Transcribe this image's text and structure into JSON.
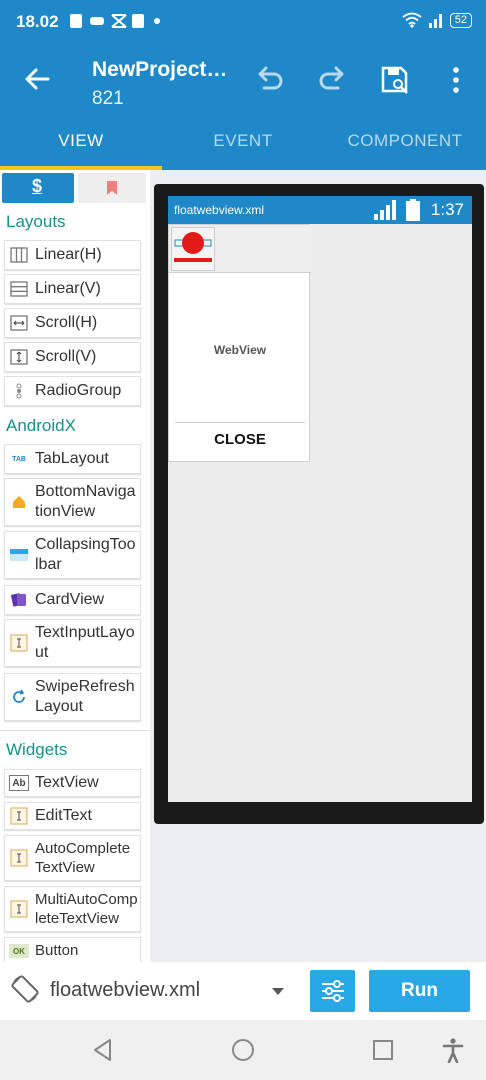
{
  "status_bar": {
    "time": "18.02",
    "battery": "52"
  },
  "app_bar": {
    "title": "NewProject…",
    "subtitle": "821"
  },
  "tabs": [
    {
      "label": "VIEW"
    },
    {
      "label": "EVENT"
    },
    {
      "label": "COMPONENT"
    }
  ],
  "palette": {
    "tab_label": "$",
    "categories": [
      {
        "label": "Layouts"
      },
      {
        "label": "AndroidX"
      },
      {
        "label": "Widgets"
      }
    ],
    "layouts": [
      {
        "label": "Linear(H)",
        "icon": "linear-h-icon"
      },
      {
        "label": "Linear(V)",
        "icon": "linear-v-icon"
      },
      {
        "label": "Scroll(H)",
        "icon": "scroll-h-icon"
      },
      {
        "label": "Scroll(V)",
        "icon": "scroll-v-icon"
      },
      {
        "label": "RadioGroup",
        "icon": "radiogroup-icon"
      }
    ],
    "androidx": [
      {
        "label": "TabLayout",
        "icon": "tab-icon",
        "icon_text": "TAB"
      },
      {
        "label": "BottomNavigationView",
        "icon": "home-icon"
      },
      {
        "label": "CollapsingToolbar",
        "icon": "toolbar-icon"
      },
      {
        "label": "CardView",
        "icon": "cards-icon"
      },
      {
        "label": "TextInputLayout",
        "icon": "text-cursor-icon"
      },
      {
        "label": "SwipeRefreshLayout",
        "icon": "refresh-icon"
      }
    ],
    "widgets": [
      {
        "label": "TextView",
        "icon": "textview-icon",
        "icon_text": "Ab"
      },
      {
        "label": "EditText",
        "icon": "edittext-icon"
      },
      {
        "label": "AutoCompleteTextView",
        "icon": "autocomplete-icon"
      },
      {
        "label": "MultiAutoCompleteTextView",
        "icon": "multiautocomplete-icon"
      },
      {
        "label": "Button",
        "icon": "button-icon",
        "icon_text": "OK"
      }
    ]
  },
  "preview": {
    "file_name": "floatwebview.xml",
    "time": "1:37",
    "webview_label": "WebView",
    "close_label": "CLOSE"
  },
  "bottom_bar": {
    "file_select_value": "floatwebview.xml",
    "run_label": "Run"
  },
  "colors": {
    "primary": "#1e88c8",
    "accent": "#f5c518",
    "button": "#29a8e8",
    "category": "#17918a"
  }
}
